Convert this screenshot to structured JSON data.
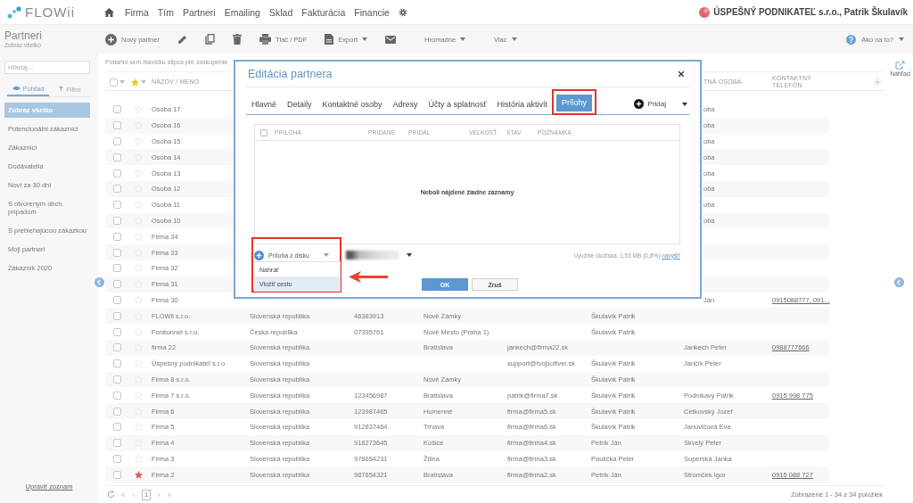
{
  "topbar": {
    "logo": "FLOWii",
    "nav": [
      "Firma",
      "Tím",
      "Partneri",
      "Emailing",
      "Sklad",
      "Fakturácia",
      "Financie"
    ],
    "account": "ÚSPEŠNÝ PODNIKATEĽ s.r.o., Patrik Škulavík"
  },
  "toolbar": {
    "title": "Partneri",
    "subtitle": "Zobraz všetko",
    "items": [
      {
        "kind": "new",
        "label": "Nový partner"
      },
      {
        "kind": "edit"
      },
      {
        "kind": "copy"
      },
      {
        "kind": "delete"
      },
      {
        "kind": "print",
        "label": "Tlač / PDF"
      },
      {
        "kind": "export",
        "label": "Export",
        "dropdown": true
      },
      {
        "kind": "mail"
      },
      {
        "kind": "menu",
        "label": "Hromadne",
        "dropdown": true
      },
      {
        "kind": "menu",
        "label": "Viac",
        "dropdown": true
      }
    ],
    "help": {
      "label": "Ako na to?",
      "dropdown": true
    }
  },
  "sidebar": {
    "search": {
      "placeholder": "Hľadaj..."
    },
    "tabs": [
      {
        "label": "Pohľad",
        "kind": "view",
        "selected": true
      },
      {
        "label": "Filtre",
        "kind": "filter",
        "selected": false
      }
    ],
    "items": [
      {
        "label": "Zobraz všetko",
        "selected": true
      },
      {
        "label": "Potencionálni zákazníci",
        "selected": false
      },
      {
        "label": "Zákazníci",
        "selected": false
      },
      {
        "label": "Dodávatelia",
        "selected": false
      },
      {
        "label": "Noví za 30 dní",
        "selected": false
      },
      {
        "label": "S otvoreným obch. prípadom",
        "selected": false
      },
      {
        "label": "S prebiehajúcou zákazkou",
        "selected": false
      },
      {
        "label": "Moji partneri",
        "selected": false
      },
      {
        "label": "Zákazník 2020",
        "selected": false
      }
    ],
    "footer_link": "Upraviť zoznam"
  },
  "table": {
    "group_hint": "Potiahni sem hlavičku stĺpca pre zoskupenie",
    "header_checked": false,
    "columns": [
      {
        "label": "NÁZOV / MENO"
      },
      {},
      {},
      {},
      {},
      {},
      {
        "label": "TNÁ OSOBA",
        "cut": true
      },
      {
        "label": "KONTAKTNÝ TELEFÓN"
      }
    ],
    "rows": [
      {
        "checked": false,
        "starred": false,
        "cells": {
          "name": "Osoba 17",
          "contact": {
            "text": "oba",
            "cut": true
          }
        }
      },
      {
        "checked": false,
        "starred": false,
        "cells": {
          "name": "Osoba 16",
          "contact": {
            "text": "oba",
            "cut": true
          }
        }
      },
      {
        "checked": false,
        "starred": false,
        "cells": {
          "name": "Osoba 15",
          "contact": {
            "text": "oba",
            "cut": true
          }
        }
      },
      {
        "checked": false,
        "starred": false,
        "cells": {
          "name": "Osoba 14",
          "contact": {
            "text": "oba",
            "cut": true
          }
        }
      },
      {
        "checked": false,
        "starred": false,
        "cells": {
          "name": "Osoba 13",
          "contact": {
            "text": "oba",
            "cut": true
          }
        }
      },
      {
        "checked": false,
        "starred": false,
        "cells": {
          "name": "Osoba 12",
          "contact": {
            "text": "oba",
            "cut": true
          }
        }
      },
      {
        "checked": false,
        "starred": false,
        "cells": {
          "name": "Osoba 11",
          "contact": {
            "text": "oba",
            "cut": true
          }
        }
      },
      {
        "checked": false,
        "starred": false,
        "cells": {
          "name": "Osoba 10",
          "contact": {
            "text": "oba",
            "cut": true
          }
        }
      },
      {
        "checked": false,
        "starred": false,
        "cells": {
          "name": "Firma 34"
        }
      },
      {
        "checked": false,
        "starred": false,
        "cells": {
          "name": "Firma 33"
        }
      },
      {
        "checked": false,
        "starred": false,
        "cells": {
          "name": "Firma 32"
        }
      },
      {
        "checked": false,
        "starred": false,
        "cells": {
          "name": "Firma 31"
        }
      },
      {
        "checked": false,
        "starred": false,
        "cells": {
          "name": "Firma 30",
          "contact": {
            "text": "Ján",
            "cut": true
          },
          "phone": "0915088777, 091..."
        }
      },
      {
        "checked": false,
        "starred": false,
        "cells": {
          "name": "FLOWii s.r.o.",
          "country": "Slovenská republika",
          "ico": "46383913",
          "city": "Nové Zámky",
          "owner": "Škulavík Patrik"
        }
      },
      {
        "checked": false,
        "starred": false,
        "cells": {
          "name": "Fontionnel s.r.o.",
          "country": "Česká republika",
          "ico": "07395761",
          "city": "Nové Mesto (Praha 1)",
          "owner": "Škulavík Patrik"
        }
      },
      {
        "checked": false,
        "starred": false,
        "cells": {
          "name": "firma 22",
          "country": "Slovenská republika",
          "city": "Bratislava",
          "email": "jankech@firma22.sk",
          "contact": "Jankech Peter",
          "phone": "0988777666"
        }
      },
      {
        "checked": false,
        "starred": false,
        "cells": {
          "name": "Úspešný podnikateľ s.r.o.",
          "country": "Slovenská republika",
          "email": "support@tvojsoftver.sk",
          "owner": "Škulavík Patrik",
          "contact": "Jančík Peter"
        }
      },
      {
        "checked": false,
        "starred": false,
        "cells": {
          "name": "Firma 8 s.r.o.",
          "country": "Slovenská republika",
          "city": "Nové Zámky",
          "owner": "Škulavík Patrik"
        }
      },
      {
        "checked": false,
        "starred": false,
        "cells": {
          "name": "Firma 7 s.r.o.",
          "country": "Slovenská republika",
          "ico": "123456987",
          "city": "Bratislava",
          "email": "patrik@firma7.sk",
          "owner": "Škulavík Patrik",
          "contact": "Podnikavý Patrik",
          "phone": "0915 998 775"
        }
      },
      {
        "checked": false,
        "starred": false,
        "cells": {
          "name": "Firma 6",
          "country": "Slovenská republika",
          "ico": "123987465",
          "city": "Humenné",
          "email": "firma@firma5.sk",
          "owner": "Škulavík Patrik",
          "contact": "Cetkovský Jozef"
        }
      },
      {
        "checked": false,
        "starred": false,
        "cells": {
          "name": "Firma 5",
          "country": "Slovenská republika",
          "ico": "912837464",
          "city": "Trnava",
          "email": "firma@firma6.sk",
          "owner": "Škulavík Patrik",
          "contact": "Janovičová Eva"
        }
      },
      {
        "checked": false,
        "starred": false,
        "cells": {
          "name": "Firma 4",
          "country": "Slovenská republika",
          "ico": "918273645",
          "city": "Košice",
          "email": "firma@firma4.sk",
          "owner": "Petrík Ján",
          "contact": "Skvelý Peter"
        }
      },
      {
        "checked": false,
        "starred": false,
        "cells": {
          "name": "Firma 3",
          "country": "Slovenská republika",
          "ico": "978654231",
          "city": "Žilina",
          "email": "firma@firma3.sk",
          "owner": "Paulička Peter",
          "contact": "Superská Janka"
        }
      },
      {
        "checked": false,
        "starred": true,
        "cells": {
          "name": "Firma 2",
          "country": "Slovenská republika",
          "ico": "987654321",
          "city": "Bratislava",
          "email": "firma@firma2.sk",
          "owner": "Petrík Ján",
          "contact": "Stromček Igor",
          "phone": "0915 088 727"
        }
      }
    ],
    "pager": {
      "pages": [
        {
          "label": "1",
          "selected": true
        }
      ],
      "summary": "Zobrazené 1 - 34 z 34 položiek"
    }
  },
  "preview": {
    "label": "Náhľad"
  },
  "dialog": {
    "title": "Editácia partnera",
    "tabs": [
      {
        "label": "Hlavné",
        "selected": false,
        "highlighted": false
      },
      {
        "label": "Detaily",
        "selected": false,
        "highlighted": false
      },
      {
        "label": "Kontaktné osoby",
        "selected": false,
        "highlighted": false
      },
      {
        "label": "Adresy",
        "selected": false,
        "highlighted": false
      },
      {
        "label": "Účty a splatnosť",
        "selected": false,
        "highlighted": false
      },
      {
        "label": "História aktivít",
        "selected": false,
        "highlighted": false
      },
      {
        "label": "Prílohy",
        "selected": true,
        "highlighted": true
      }
    ],
    "add": {
      "label": "Pridaj",
      "dropdown": true
    },
    "grid": {
      "checked": false,
      "columns": [
        "PRÍLOHA",
        "PRIDANÉ",
        "PRIDAL",
        "VEĽKOSŤ",
        "STAV",
        "POZNÁMKA"
      ],
      "empty": "Neboli nájdené žiadne záznamy"
    },
    "upload": {
      "label": "Príloha z disku",
      "highlighted": true,
      "menu": [
        {
          "label": "Nahrať",
          "selected": false
        },
        {
          "label": "Vložiť cestu",
          "selected": true
        }
      ]
    },
    "storage": {
      "text": "Využitie úložiska: 1,53 MB (0,8%)",
      "link": "navýšiť"
    },
    "buttons": [
      {
        "label": "OK",
        "kind": "primary"
      },
      {
        "label": "Zruš",
        "kind": "secondary"
      }
    ]
  }
}
